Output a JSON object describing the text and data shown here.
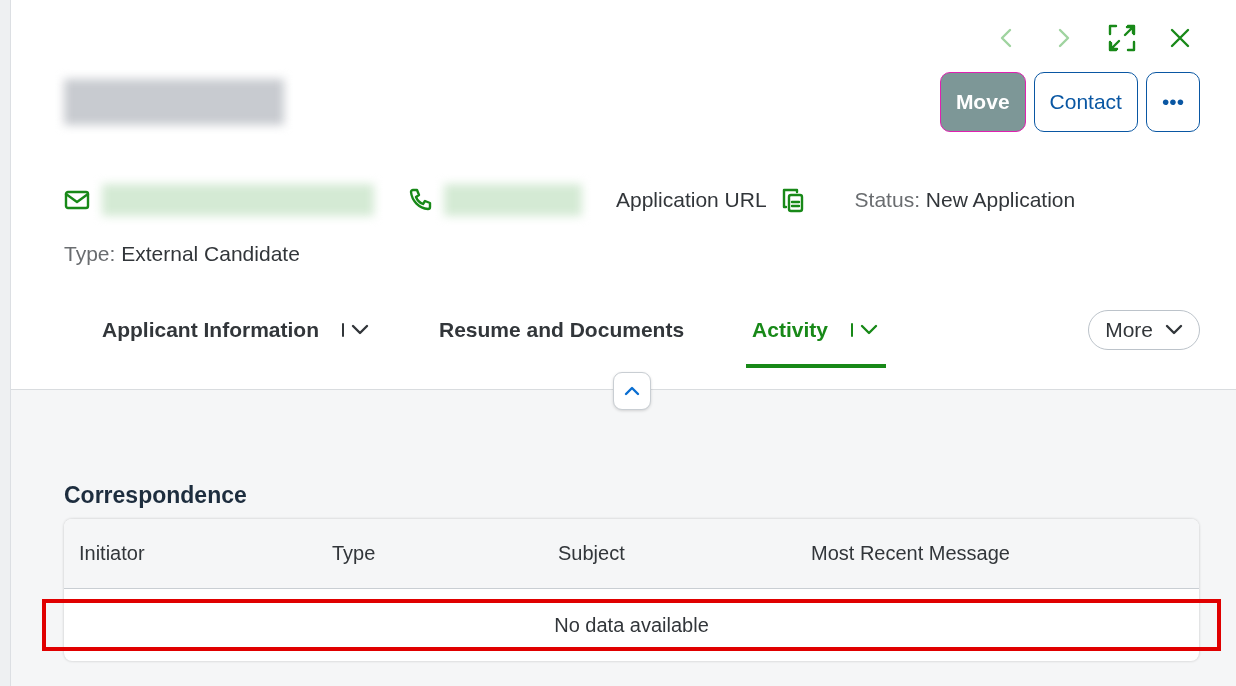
{
  "nav": [
    {
      "kind": "prev",
      "disabled": true
    },
    {
      "kind": "next",
      "disabled": true
    },
    {
      "kind": "expand",
      "disabled": false
    },
    {
      "kind": "close",
      "disabled": false
    }
  ],
  "actions": [
    {
      "label": "Move",
      "kind": "primary",
      "focused": true
    },
    {
      "label": "Contact",
      "kind": "secondary",
      "focused": false
    },
    {
      "label": "•••",
      "kind": "secondary",
      "focused": false
    }
  ],
  "contact": [
    {
      "kind": "email"
    },
    {
      "kind": "phone"
    }
  ],
  "application_url": {
    "label": "Application URL"
  },
  "status": {
    "label": "Status:",
    "value": "New Application"
  },
  "type": {
    "label": "Type:",
    "value": "External Candidate"
  },
  "tabs": [
    {
      "label": "Applicant Information",
      "selected": false,
      "has_menu": true
    },
    {
      "label": "Resume and Documents",
      "selected": false,
      "has_menu": false
    },
    {
      "label": "Activity",
      "selected": true,
      "has_menu": true
    }
  ],
  "more": {
    "label": "More"
  },
  "section": {
    "title": "Correspondence"
  },
  "table": {
    "columns": [
      "Initiator",
      "Type",
      "Subject",
      "Most Recent Message"
    ],
    "empty_text": "No data available",
    "empty_row_highlighted": true
  }
}
